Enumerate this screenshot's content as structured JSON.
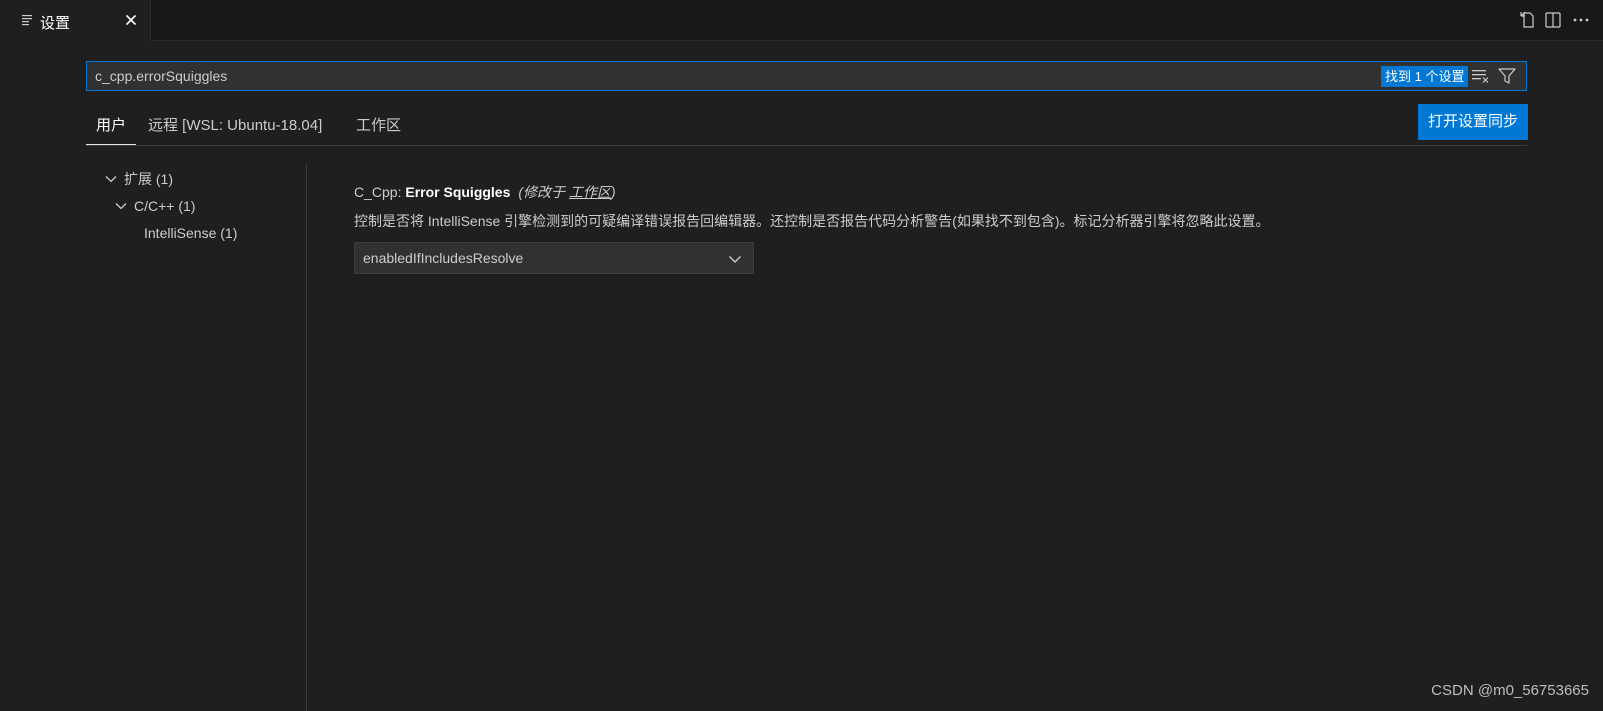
{
  "tab": {
    "label": "设置",
    "icon": "settings-list-icon",
    "close_icon": "close-icon"
  },
  "editor_actions": [
    {
      "name": "open-settings-json-icon"
    },
    {
      "name": "split-editor-icon"
    },
    {
      "name": "more-actions-icon"
    }
  ],
  "search": {
    "value": "c_cpp.errorSquiggles",
    "result_badge": "找到 1 个设置",
    "clear_icon": "clear-filter-icon",
    "filter_icon": "filter-icon"
  },
  "scopes": [
    {
      "label": "用户",
      "active": true
    },
    {
      "label": "远程 [WSL: Ubuntu-18.04]",
      "active": false
    },
    {
      "label": "工作区",
      "active": false
    }
  ],
  "sync_button": "打开设置同步",
  "toc": [
    {
      "label": "扩展 (1)",
      "level": 0,
      "expanded": true
    },
    {
      "label": "C/C++ (1)",
      "level": 1,
      "expanded": true
    },
    {
      "label": "IntelliSense (1)",
      "level": 2,
      "expanded": false
    }
  ],
  "setting": {
    "category": "C_Cpp: ",
    "name": "Error Squiggles",
    "modified_prefix": "(修改于 ",
    "modified_link": "工作区",
    "modified_suffix": ")",
    "description": "控制是否将 IntelliSense 引擎检测到的可疑编译错误报告回编辑器。还控制是否报告代码分析警告(如果找不到包含)。标记分析器引擎将忽略此设置。",
    "value": "enabledIfIncludesResolve"
  },
  "watermark": "CSDN @m0_56753665",
  "colors": {
    "accent": "#0078d4",
    "background": "#1f1f1f",
    "tabbar": "#181818"
  }
}
